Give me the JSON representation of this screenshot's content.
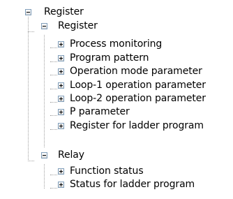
{
  "tree": {
    "root": {
      "label": "Register",
      "state": "expanded",
      "children": [
        {
          "label": "Register",
          "state": "expanded",
          "items": [
            {
              "label": "Process monitoring",
              "state": "collapsed"
            },
            {
              "label": "Program pattern",
              "state": "collapsed"
            },
            {
              "label": "Operation mode parameter",
              "state": "collapsed"
            },
            {
              "label": "Loop-1 operation parameter",
              "state": "collapsed"
            },
            {
              "label": "Loop-2 operation parameter",
              "state": "collapsed"
            },
            {
              "label": "P parameter",
              "state": "collapsed"
            },
            {
              "label": "Register for ladder program",
              "state": "collapsed"
            }
          ]
        },
        {
          "label": "Relay",
          "state": "expanded",
          "items": [
            {
              "label": "Function status",
              "state": "collapsed"
            },
            {
              "label": "Status for ladder program",
              "state": "collapsed"
            }
          ]
        }
      ]
    }
  }
}
